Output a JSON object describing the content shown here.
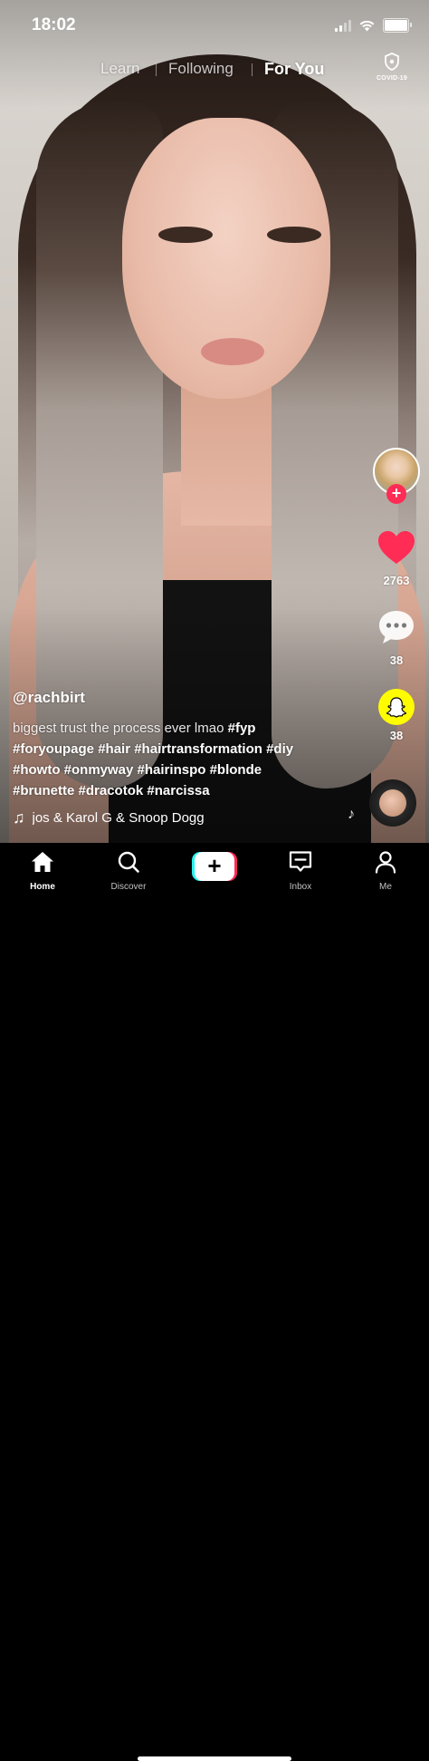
{
  "status_bar": {
    "time": "18:02"
  },
  "top_nav": {
    "tabs": [
      "Learn",
      "Following",
      "For You"
    ],
    "active_tab": "For You",
    "covid_label": "COVID-19"
  },
  "rail": {
    "like_count": "2763",
    "comment_count": "38",
    "share_count": "38",
    "colors": {
      "like": "#ff2c55",
      "snapchat": "#fffc00",
      "follow_plus": "#ff2c55"
    }
  },
  "video": {
    "author": "@rachbirt",
    "caption_text": "biggest trust the process ever lmao",
    "hashtags": [
      "#fyp",
      "#foryoupage",
      "#hair",
      "#hairtransformation",
      "#diy",
      "#howto",
      "#onmyway",
      "#hairinspo",
      "#blonde",
      "#brunette",
      "#dracotok",
      "#narcissa"
    ],
    "music": "jos & Karol G & Snoop Dogg"
  },
  "bottom_nav": {
    "items": [
      {
        "label": "Home",
        "icon": "home-icon"
      },
      {
        "label": "Discover",
        "icon": "search-icon"
      },
      {
        "label": "",
        "icon": "plus-icon"
      },
      {
        "label": "Inbox",
        "icon": "inbox-icon"
      },
      {
        "label": "Me",
        "icon": "profile-icon"
      }
    ]
  }
}
